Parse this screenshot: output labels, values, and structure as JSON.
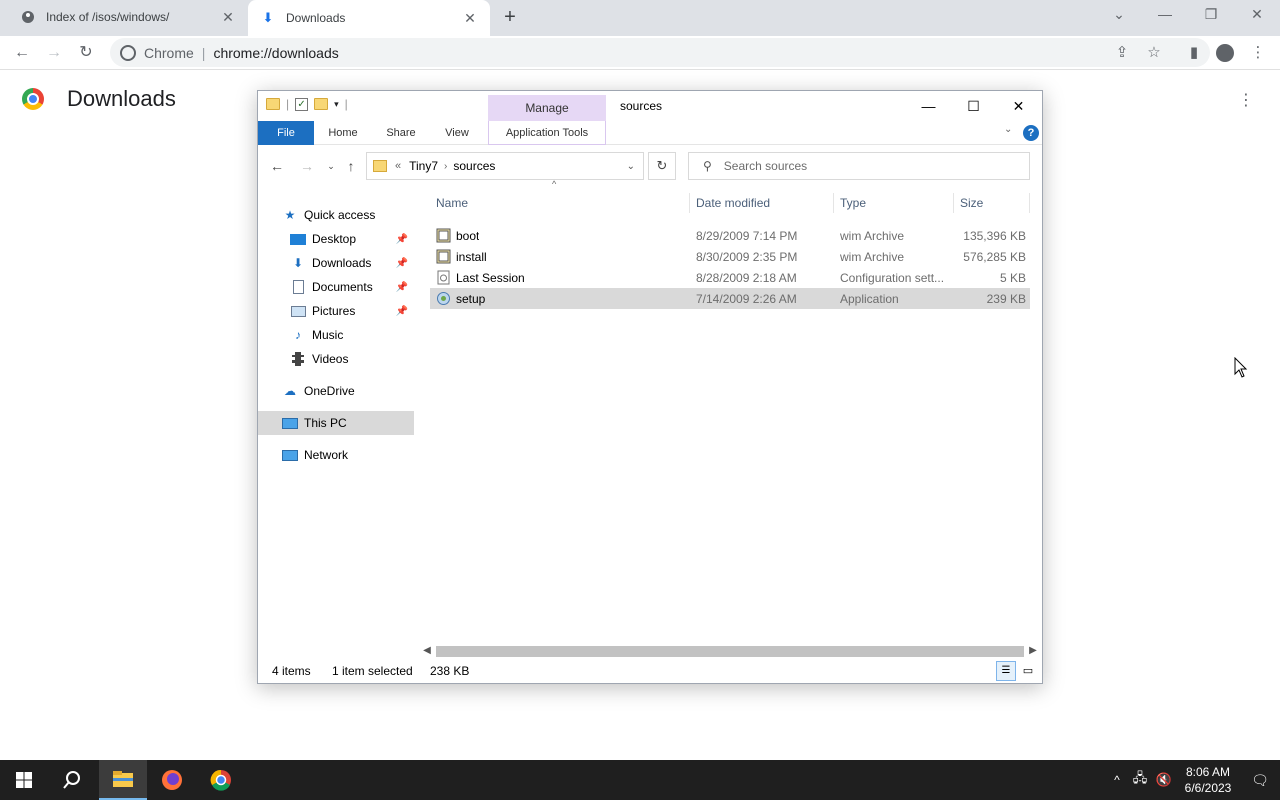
{
  "chrome": {
    "tabs": [
      {
        "title": "Index of /isos/windows/"
      },
      {
        "title": "Downloads"
      }
    ],
    "omnibox": {
      "scheme_label": "Chrome",
      "url": "chrome://downloads"
    }
  },
  "downloads_page": {
    "title": "Downloads"
  },
  "explorer": {
    "caption": "sources",
    "contextual_tab_group": "Manage",
    "ribbon_tabs": [
      "File",
      "Home",
      "Share",
      "View",
      "Application Tools"
    ],
    "address": {
      "prefix": "«",
      "crumbs": [
        "Tiny7",
        "sources"
      ]
    },
    "search_placeholder": "Search sources",
    "nav": {
      "quick_access": "Quick access",
      "items": [
        "Desktop",
        "Downloads",
        "Documents",
        "Pictures",
        "Music",
        "Videos"
      ],
      "onedrive": "OneDrive",
      "this_pc": "This PC",
      "network": "Network"
    },
    "columns": [
      "Name",
      "Date modified",
      "Type",
      "Size"
    ],
    "files": [
      {
        "name": "boot",
        "date": "8/29/2009 7:14 PM",
        "type": "wim Archive",
        "size": "135,396 KB"
      },
      {
        "name": "install",
        "date": "8/30/2009 2:35 PM",
        "type": "wim Archive",
        "size": "576,285 KB"
      },
      {
        "name": "Last Session",
        "date": "8/28/2009 2:18 AM",
        "type": "Configuration sett...",
        "size": "5 KB"
      },
      {
        "name": "setup",
        "date": "7/14/2009 2:26 AM",
        "type": "Application",
        "size": "239 KB"
      }
    ],
    "status": {
      "items": "4 items",
      "selected": "1 item selected",
      "size": "238 KB"
    }
  },
  "taskbar": {
    "time": "8:06 AM",
    "date": "6/6/2023"
  },
  "colors": {
    "file_tab": "#1c6fc1",
    "manage_tab": "#e6d8f5",
    "selection": "#d9d9d9",
    "taskbar": "#1f1f1f"
  }
}
